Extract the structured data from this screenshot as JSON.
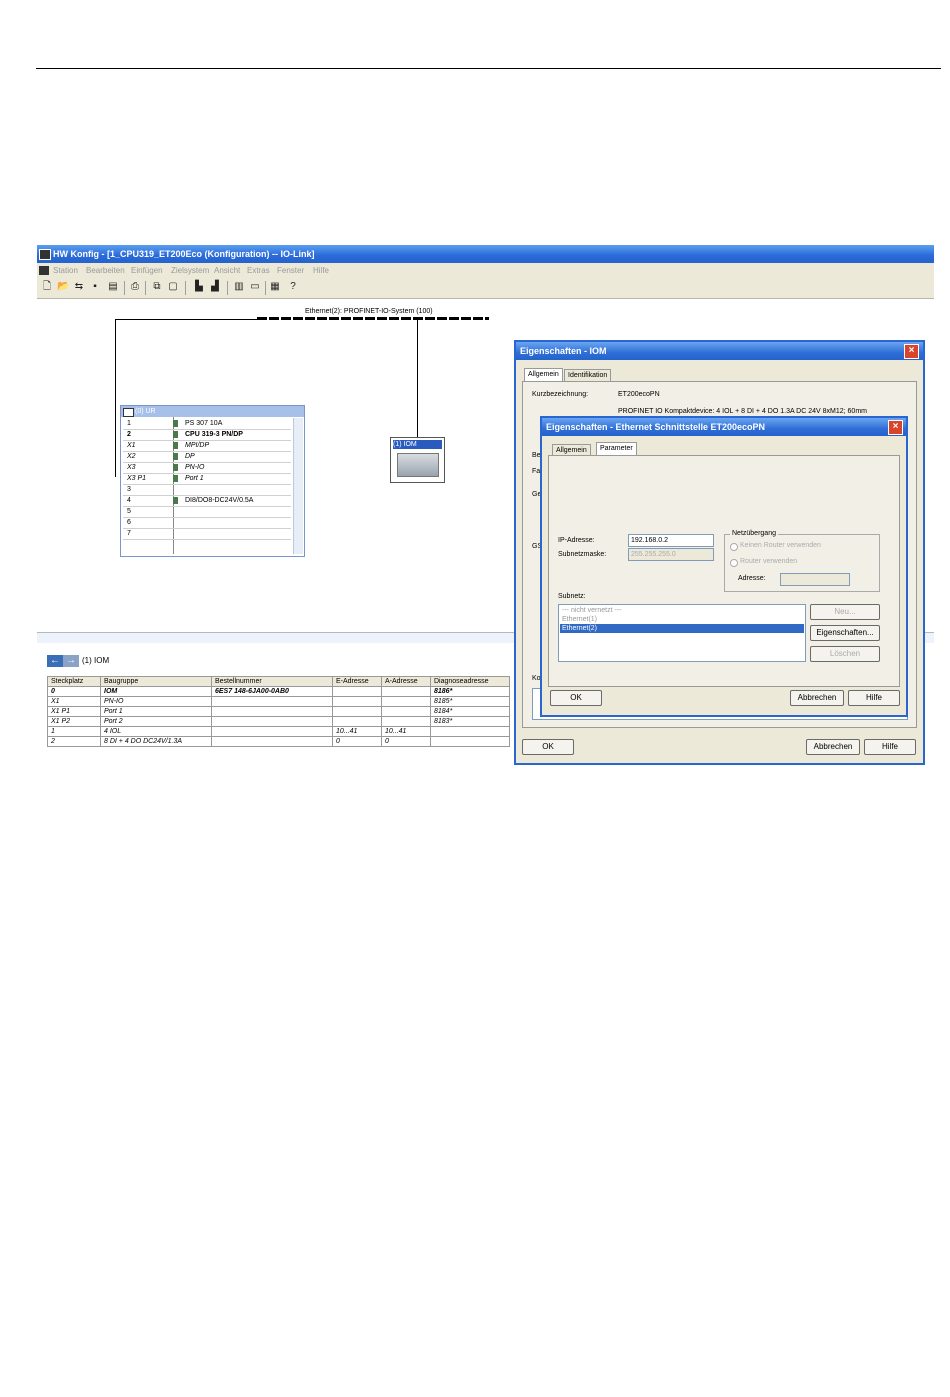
{
  "window": {
    "title": "HW Konfig - [1_CPU319_ET200Eco (Konfiguration) -- IO-Link]",
    "menu": [
      "Station",
      "Bearbeiten",
      "Einfügen",
      "Zielsystem",
      "Ansicht",
      "Extras",
      "Fenster",
      "Hilfe"
    ]
  },
  "network": {
    "bus_label": "Ethernet(2): PROFINET-IO-System (100)"
  },
  "rack": {
    "title": "(0) UR",
    "rows": [
      {
        "slot": "1",
        "module": "PS 307 10A"
      },
      {
        "slot": "2",
        "module": "CPU 319-3 PN/DP"
      },
      {
        "slot": "X1",
        "module": "MPI/DP"
      },
      {
        "slot": "X2",
        "module": "DP"
      },
      {
        "slot": "X3",
        "module": "PN-IO"
      },
      {
        "slot": "X3 P1",
        "module": "Port 1"
      },
      {
        "slot": "3",
        "module": ""
      },
      {
        "slot": "4",
        "module": "DI8/DO8-DC24V/0.5A"
      },
      {
        "slot": "5",
        "module": ""
      },
      {
        "slot": "6",
        "module": ""
      },
      {
        "slot": "7",
        "module": ""
      }
    ]
  },
  "device": {
    "label": "(1) IOM"
  },
  "detail": {
    "title": "(1)  IOM",
    "headers": [
      "Steckplatz",
      "Baugruppe",
      "Bestellnummer",
      "E-Adresse",
      "A-Adresse",
      "Diagnoseadresse"
    ],
    "rows": [
      [
        "0",
        "IOM",
        "6ES7 148-6JA00-0AB0",
        "",
        "",
        "8186*"
      ],
      [
        "X1",
        "PN-IO",
        "",
        "",
        "",
        "8185*"
      ],
      [
        "X1 P1",
        "Port 1",
        "",
        "",
        "",
        "8184*"
      ],
      [
        "X1 P2",
        "Port 2",
        "",
        "",
        "",
        "8183*"
      ],
      [
        "1",
        "4 IOL",
        "",
        "10...41",
        "10...41",
        ""
      ],
      [
        "2",
        "8 DI + 4 DO DC24V/1.3A",
        "",
        "0",
        "0",
        ""
      ]
    ]
  },
  "dialog1": {
    "title": "Eigenschaften - IOM",
    "tabs": [
      "Allgemein",
      "Identifikation"
    ],
    "short_label": "Kurzbezeichnung:",
    "short_value": "ET200ecoPN",
    "desc_value": "PROFINET IO Kompaktdevice: 4 IOL + 8 DI + 4 DO 1.3A DC 24V 8xM12; 60mm",
    "partial": [
      "Be",
      "Fa",
      "Ge",
      "GS",
      "Ko"
    ],
    "ok": "OK",
    "cancel": "Abbrechen",
    "help": "Hilfe"
  },
  "dialog2": {
    "title": "Eigenschaften - Ethernet Schnittstelle  ET200ecoPN",
    "tabs": [
      "Allgemein",
      "Parameter"
    ],
    "ip_label": "IP-Adresse:",
    "ip_value": "192.168.0.2",
    "mask_label": "Subnetzmaske:",
    "mask_value": "255.255.255.0",
    "gateway_title": "Netzübergang",
    "radio1": "Keinen Router verwenden",
    "radio2": "Router verwenden",
    "addr_label": "Adresse:",
    "subnet_label": "Subnetz:",
    "subnets": [
      "--- nicht vernetzt ---",
      "Ethernet(1)",
      "Ethernet(2)"
    ],
    "new_btn": "Neu...",
    "props_btn": "Eigenschaften...",
    "delete_btn": "Löschen",
    "ok": "OK",
    "cancel": "Abbrechen",
    "help": "Hilfe"
  }
}
